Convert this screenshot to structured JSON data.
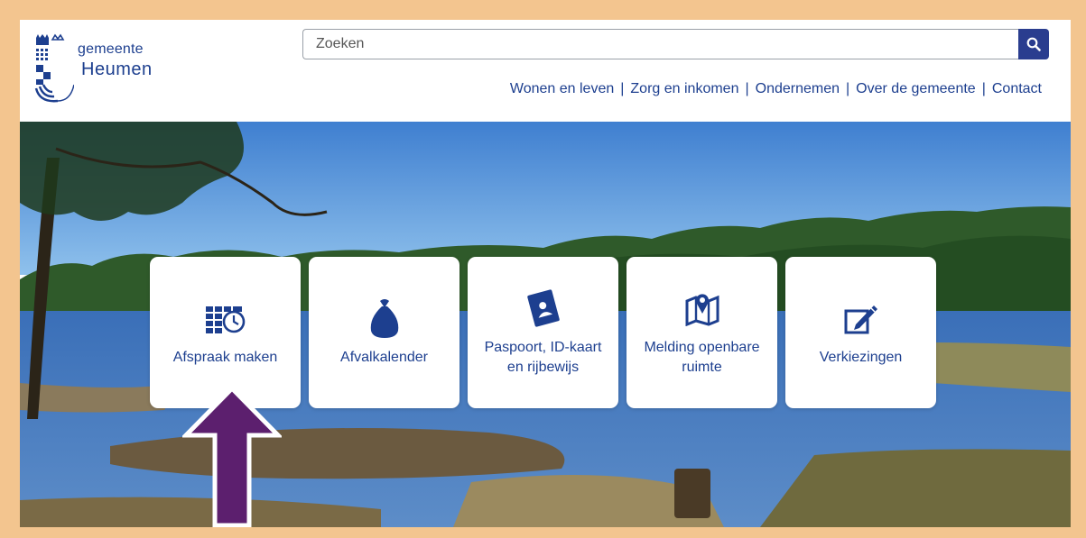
{
  "logo": {
    "line1": "gemeente",
    "line2": "Heumen"
  },
  "search": {
    "placeholder": "Zoeken"
  },
  "nav": {
    "items": [
      {
        "label": "Wonen en leven"
      },
      {
        "label": "Zorg en inkomen"
      },
      {
        "label": "Ondernemen"
      },
      {
        "label": "Over de gemeente"
      },
      {
        "label": "Contact"
      }
    ],
    "separator": "|"
  },
  "tiles": [
    {
      "label": "Afspraak maken",
      "icon": "calendar-clock-icon"
    },
    {
      "label": "Afvalkalender",
      "icon": "garbage-bag-icon"
    },
    {
      "label": "Paspoort, ID-kaart\nen rijbewijs",
      "icon": "passport-icon"
    },
    {
      "label": "Melding openbare\nruimte",
      "icon": "map-marker-icon"
    },
    {
      "label": "Verkiezingen",
      "icon": "ballot-pencil-icon"
    }
  ],
  "colors": {
    "brand": "#1d3f8f",
    "search_button": "#2a3d8f",
    "frame": "#f3c58f",
    "arrow": "#5c1f6e"
  }
}
